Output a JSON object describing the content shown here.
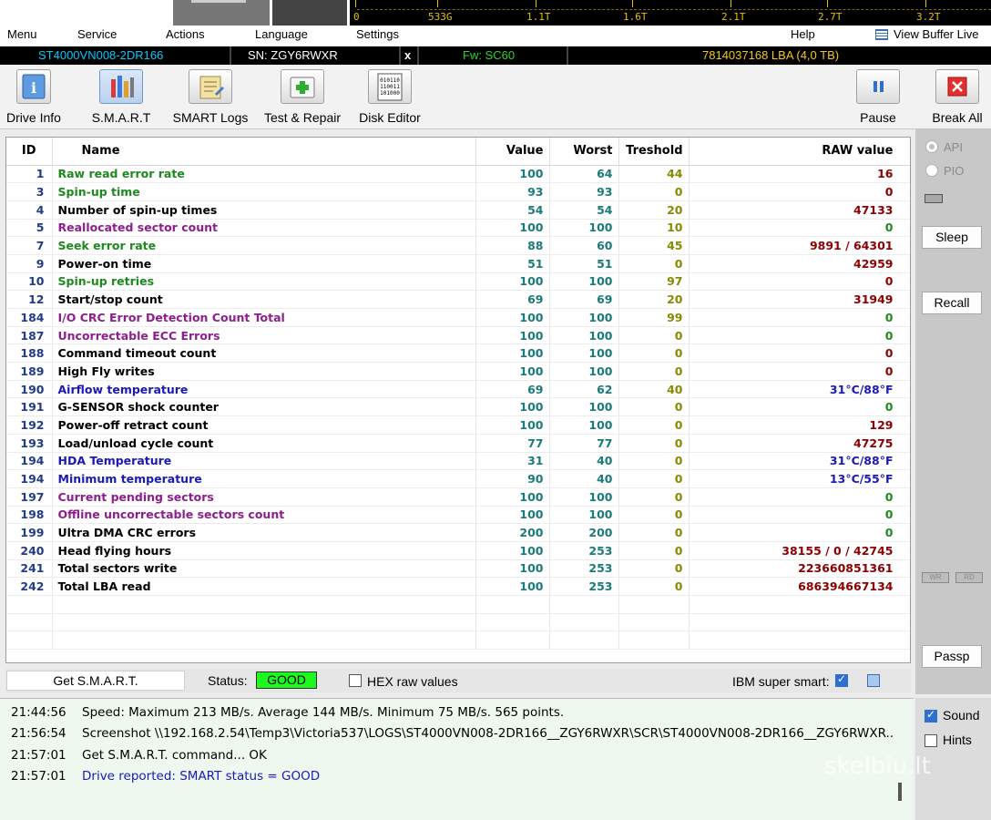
{
  "graph_scale": [
    "0",
    "533G",
    "1.1T",
    "1.6T",
    "2.1T",
    "2.7T",
    "3.2T"
  ],
  "menu": {
    "items": [
      "Menu",
      "Service",
      "Actions",
      "Language",
      "Settings",
      "Help"
    ],
    "view_buffer": "View Buffer Live"
  },
  "drive_bar": {
    "model": "ST4000VN008-2DR166",
    "serial": "SN: ZGY6RWXR",
    "close": "x",
    "firmware": "Fw: SC60",
    "capacity": "7814037168 LBA (4,0 TB)"
  },
  "toolbar": {
    "drive_info": "Drive Info",
    "smart": "S.M.A.R.T",
    "smart_logs": "SMART Logs",
    "test_repair": "Test & Repair",
    "disk_editor": "Disk Editor",
    "pause": "Pause",
    "break_all": "Break All"
  },
  "table": {
    "headers": {
      "id": "ID",
      "name": "Name",
      "value": "Value",
      "worst": "Worst",
      "threshold": "Treshold",
      "raw": "RAW value"
    },
    "rows": [
      {
        "id": "1",
        "name": "Raw read error rate",
        "value": "100",
        "worst": "64",
        "threshold": "44",
        "raw": "16",
        "name_color": "#1c8a1c",
        "raw_color": "#8b0000"
      },
      {
        "id": "3",
        "name": "Spin-up time",
        "value": "93",
        "worst": "93",
        "threshold": "0",
        "raw": "0",
        "name_color": "#1c8a1c",
        "raw_color": "#8b0000"
      },
      {
        "id": "4",
        "name": "Number of spin-up times",
        "value": "54",
        "worst": "54",
        "threshold": "20",
        "raw": "47133",
        "name_color": "#000000",
        "raw_color": "#8b0000"
      },
      {
        "id": "5",
        "name": "Reallocated sector count",
        "value": "100",
        "worst": "100",
        "threshold": "10",
        "raw": "0",
        "name_color": "#8e1e8e",
        "raw_color": "#1c8a1c"
      },
      {
        "id": "7",
        "name": "Seek error rate",
        "value": "88",
        "worst": "60",
        "threshold": "45",
        "raw": "9891 / 64301",
        "name_color": "#1c8a1c",
        "raw_color": "#8b0000"
      },
      {
        "id": "9",
        "name": "Power-on time",
        "value": "51",
        "worst": "51",
        "threshold": "0",
        "raw": "42959",
        "name_color": "#000000",
        "raw_color": "#8b0000"
      },
      {
        "id": "10",
        "name": "Spin-up retries",
        "value": "100",
        "worst": "100",
        "threshold": "97",
        "raw": "0",
        "name_color": "#1c8a1c",
        "raw_color": "#8b0000"
      },
      {
        "id": "12",
        "name": "Start/stop count",
        "value": "69",
        "worst": "69",
        "threshold": "20",
        "raw": "31949",
        "name_color": "#000000",
        "raw_color": "#8b0000"
      },
      {
        "id": "184",
        "name": "I/O CRC Error Detection Count Total",
        "value": "100",
        "worst": "100",
        "threshold": "99",
        "raw": "0",
        "name_color": "#8e1e8e",
        "raw_color": "#1c8a1c"
      },
      {
        "id": "187",
        "name": "Uncorrectable ECC Errors",
        "value": "100",
        "worst": "100",
        "threshold": "0",
        "raw": "0",
        "name_color": "#8e1e8e",
        "raw_color": "#1c8a1c"
      },
      {
        "id": "188",
        "name": "Command timeout count",
        "value": "100",
        "worst": "100",
        "threshold": "0",
        "raw": "0",
        "name_color": "#000000",
        "raw_color": "#8b0000"
      },
      {
        "id": "189",
        "name": "High Fly writes",
        "value": "100",
        "worst": "100",
        "threshold": "0",
        "raw": "0",
        "name_color": "#000000",
        "raw_color": "#8b0000"
      },
      {
        "id": "190",
        "name": "Airflow temperature",
        "value": "69",
        "worst": "62",
        "threshold": "40",
        "raw": "31°C/88°F",
        "name_color": "#1a1ab8",
        "raw_color": "#1a1ab8"
      },
      {
        "id": "191",
        "name": "G-SENSOR shock counter",
        "value": "100",
        "worst": "100",
        "threshold": "0",
        "raw": "0",
        "name_color": "#000000",
        "raw_color": "#1c8a1c"
      },
      {
        "id": "192",
        "name": "Power-off retract count",
        "value": "100",
        "worst": "100",
        "threshold": "0",
        "raw": "129",
        "name_color": "#000000",
        "raw_color": "#8b0000"
      },
      {
        "id": "193",
        "name": "Load/unload cycle count",
        "value": "77",
        "worst": "77",
        "threshold": "0",
        "raw": "47275",
        "name_color": "#000000",
        "raw_color": "#8b0000"
      },
      {
        "id": "194",
        "name": "HDA Temperature",
        "value": "31",
        "worst": "40",
        "threshold": "0",
        "raw": "31°C/88°F",
        "name_color": "#1a1ab8",
        "raw_color": "#1a1ab8"
      },
      {
        "id": "194",
        "name": "Minimum temperature",
        "value": "90",
        "worst": "40",
        "threshold": "0",
        "raw": "13°C/55°F",
        "name_color": "#1a1ab8",
        "raw_color": "#1a1ab8"
      },
      {
        "id": "197",
        "name": "Current pending sectors",
        "value": "100",
        "worst": "100",
        "threshold": "0",
        "raw": "0",
        "name_color": "#8e1e8e",
        "raw_color": "#1c8a1c"
      },
      {
        "id": "198",
        "name": "Offline uncorrectable sectors count",
        "value": "100",
        "worst": "100",
        "threshold": "0",
        "raw": "0",
        "name_color": "#8e1e8e",
        "raw_color": "#1c8a1c"
      },
      {
        "id": "199",
        "name": "Ultra DMA CRC errors",
        "value": "200",
        "worst": "200",
        "threshold": "0",
        "raw": "0",
        "name_color": "#000000",
        "raw_color": "#1c8a1c"
      },
      {
        "id": "240",
        "name": "Head flying hours",
        "value": "100",
        "worst": "253",
        "threshold": "0",
        "raw": "38155 / 0 / 42745",
        "name_color": "#000000",
        "raw_color": "#8b0000"
      },
      {
        "id": "241",
        "name": "Total sectors write",
        "value": "100",
        "worst": "253",
        "threshold": "0",
        "raw": "223660851361",
        "name_color": "#000000",
        "raw_color": "#8b0000"
      },
      {
        "id": "242",
        "name": "Total LBA read",
        "value": "100",
        "worst": "253",
        "threshold": "0",
        "raw": "686394667134",
        "name_color": "#000000",
        "raw_color": "#8b0000"
      }
    ]
  },
  "status_row": {
    "get_smart": "Get S.M.A.R.T.",
    "status_label": "Status:",
    "status_value": "GOOD",
    "hex_label": "HEX raw values",
    "hex_checked": false,
    "ibm_label": "IBM super smart:",
    "ibm_checked": true
  },
  "right_panel": {
    "api": "API",
    "pio": "PIO",
    "sleep": "Sleep",
    "recall": "Recall",
    "wr": "WR",
    "rd": "RD",
    "passp": "Passp"
  },
  "log": [
    {
      "time": "21:44:56",
      "text": "Speed: Maximum 213 MB/s. Average 144 MB/s. Minimum 75 MB/s. 565 points.",
      "color": "#000000"
    },
    {
      "time": "21:56:54",
      "text": "Screenshot \\\\192.168.2.54\\Temp3\\Victoria537\\LOGS\\ST4000VN008-2DR166__ZGY6RWXR\\SCR\\ST4000VN008-2DR166__ZGY6RWXR..",
      "color": "#000000"
    },
    {
      "time": "21:57:01",
      "text": "Get S.M.A.R.T. command... OK",
      "color": "#000000"
    },
    {
      "time": "21:57:01",
      "text": "Drive reported: SMART status = GOOD",
      "color": "#1a1ab8"
    }
  ],
  "log_options": {
    "sound": "Sound",
    "sound_checked": true,
    "hints": "Hints",
    "hints_checked": false
  },
  "watermark": "skelbiu.lt",
  "colors": {
    "status_good": "#1df81d",
    "model_text": "#00c8ff",
    "fw_text": "#29d629",
    "capacity_text": "#f3c51a"
  }
}
